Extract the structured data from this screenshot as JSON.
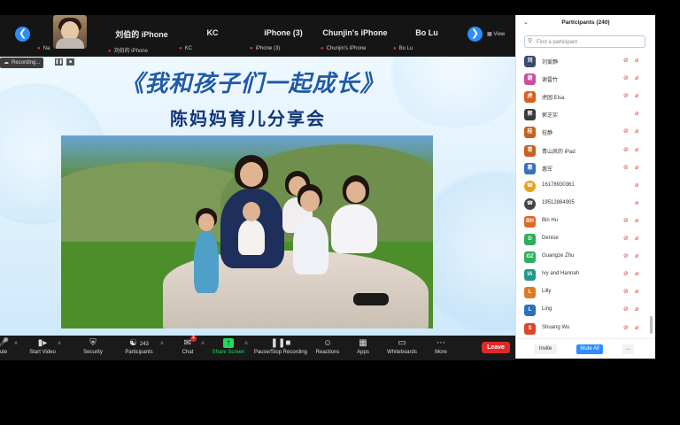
{
  "gallery": {
    "view_label": "View",
    "tiles": [
      {
        "name": "",
        "sub": "Na"
      },
      {
        "name": "刘伯的 iPhone",
        "sub": "刘伯的 iPhone"
      },
      {
        "name": "KC",
        "sub": "KC"
      },
      {
        "name": "iPhone (3)",
        "sub": "iPhone (3)"
      },
      {
        "name": "Chunjin's iPhone",
        "sub": "Chunjin's iPhone"
      },
      {
        "name": "Bo Lu",
        "sub": "Bo Lu"
      }
    ]
  },
  "recording": {
    "label": "Recording..."
  },
  "slide": {
    "title": "《我和孩子们一起成长》",
    "subtitle": "陈妈妈育儿分享会"
  },
  "toolbar": {
    "items": [
      {
        "label": "ute",
        "icon": "microphone-icon"
      },
      {
        "label": "Start Video",
        "icon": "video-icon"
      },
      {
        "label": "Security",
        "icon": "shield-icon"
      },
      {
        "label": "Participants",
        "icon": "people-icon",
        "count": "243"
      },
      {
        "label": "Chat",
        "icon": "chat-icon",
        "badge": "4"
      },
      {
        "label": "Share Screen",
        "icon": "share-screen-icon"
      },
      {
        "label": "Pause/Stop Recording",
        "icon": "pause-stop-icon"
      },
      {
        "label": "Reactions",
        "icon": "smiley-icon"
      },
      {
        "label": "Apps",
        "icon": "apps-icon"
      },
      {
        "label": "Whiteboards",
        "icon": "whiteboard-icon"
      },
      {
        "label": "More",
        "icon": "more-icon"
      }
    ],
    "leave_label": "Leave"
  },
  "colors": {
    "accent": "#2d8cff",
    "leave": "#e02828",
    "share_green": "#23d959",
    "muted_red": "#e23c3c"
  },
  "panel": {
    "title": "Participants (240)",
    "search_placeholder": "Find a participant",
    "participants": [
      {
        "name": "刘爱静",
        "avatar": "刘",
        "color": "#3a4a6b"
      },
      {
        "name": "谢雷竹",
        "avatar": "谢",
        "color": "#c84fa0"
      },
      {
        "name": "虎园 Elsa",
        "avatar": "虎",
        "color": "#d9601f"
      },
      {
        "name": "郭芝实",
        "avatar": "郭",
        "color": "#3a3a3a"
      },
      {
        "name": "桂静",
        "avatar": "桂",
        "color": "#c9601f"
      },
      {
        "name": "青山凤的 iPad",
        "avatar": "青",
        "color": "#c9601f"
      },
      {
        "name": "惠军",
        "avatar": "惠",
        "color": "#3a6fbf"
      },
      {
        "name": "16178930361",
        "avatar": "phone",
        "color": "#e8a020"
      },
      {
        "name": "19512884905",
        "avatar": "phone",
        "color": "#444"
      },
      {
        "name": "Bin Hu",
        "avatar": "BH",
        "color": "#e06a2a"
      },
      {
        "name": "Denise",
        "avatar": "D",
        "color": "#2fae5a"
      },
      {
        "name": "Guangze Zhu",
        "avatar": "GZ",
        "color": "#2fae5a"
      },
      {
        "name": "Ivy and Hannah",
        "avatar": "IA",
        "color": "#1f9a8a"
      },
      {
        "name": "Lilly",
        "avatar": "L",
        "color": "#e07a1f"
      },
      {
        "name": "Ling",
        "avatar": "L",
        "color": "#2b6fbf"
      },
      {
        "name": "Shuang Wu",
        "avatar": "S",
        "color": "#e0442a"
      }
    ],
    "invite_label": "Invite",
    "mute_all_label": "Mute All",
    "more_label": "..."
  }
}
